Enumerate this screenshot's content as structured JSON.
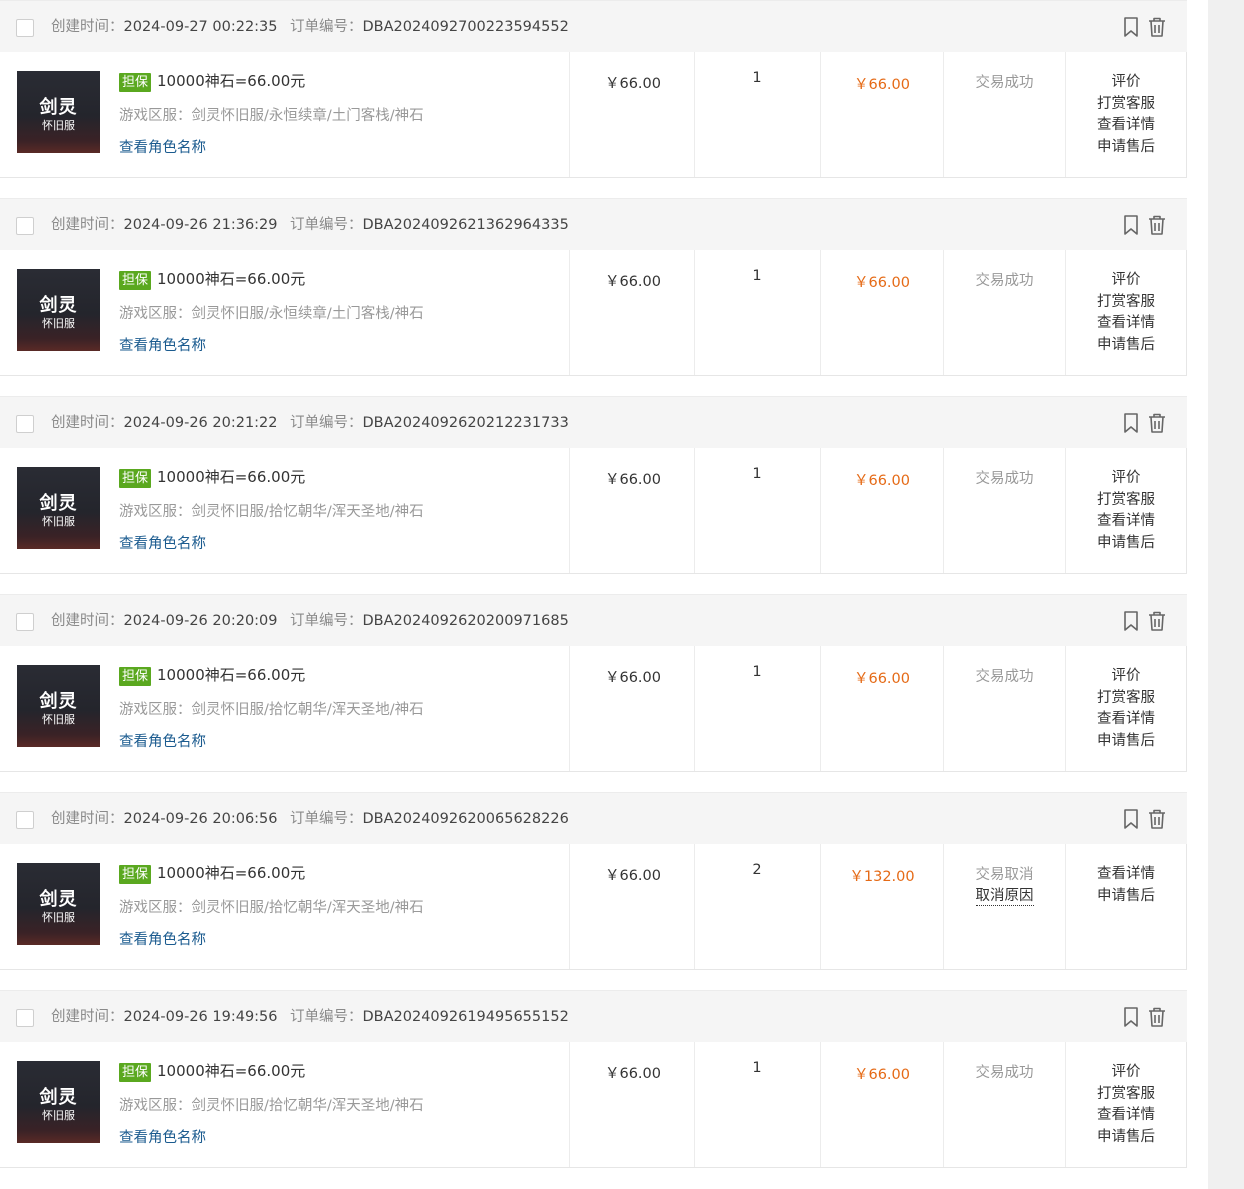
{
  "labels": {
    "created": "创建时间：",
    "order_no": "订单编号：",
    "server": "游戏区服：",
    "view_role": "查看角色名称",
    "badge": "担保"
  },
  "thumbnail": {
    "line1": "剑灵",
    "line2": "怀旧服"
  },
  "colors": {
    "accent_orange": "#e56a16",
    "badge_green": "#5aa81f",
    "link_blue": "#1b5b8f"
  },
  "orders": [
    {
      "created": "2024-09-27 00:22:35",
      "order_no": "DBA2024092700223594552",
      "product": "10000神石=66.00元",
      "server": "剑灵怀旧服/永恒续章/土门客栈/神石",
      "price": "￥66.00",
      "qty": "1",
      "total": "￥66.00",
      "status": "交易成功",
      "status_link": "",
      "actions": [
        "评价",
        "打赏客服",
        "查看详情",
        "申请售后"
      ]
    },
    {
      "created": "2024-09-26 21:36:29",
      "order_no": "DBA2024092621362964335",
      "product": "10000神石=66.00元",
      "server": "剑灵怀旧服/永恒续章/土门客栈/神石",
      "price": "￥66.00",
      "qty": "1",
      "total": "￥66.00",
      "status": "交易成功",
      "status_link": "",
      "actions": [
        "评价",
        "打赏客服",
        "查看详情",
        "申请售后"
      ]
    },
    {
      "created": "2024-09-26 20:21:22",
      "order_no": "DBA2024092620212231733",
      "product": "10000神石=66.00元",
      "server": "剑灵怀旧服/拾忆朝华/浑天圣地/神石",
      "price": "￥66.00",
      "qty": "1",
      "total": "￥66.00",
      "status": "交易成功",
      "status_link": "",
      "actions": [
        "评价",
        "打赏客服",
        "查看详情",
        "申请售后"
      ]
    },
    {
      "created": "2024-09-26 20:20:09",
      "order_no": "DBA2024092620200971685",
      "product": "10000神石=66.00元",
      "server": "剑灵怀旧服/拾忆朝华/浑天圣地/神石",
      "price": "￥66.00",
      "qty": "1",
      "total": "￥66.00",
      "status": "交易成功",
      "status_link": "",
      "actions": [
        "评价",
        "打赏客服",
        "查看详情",
        "申请售后"
      ]
    },
    {
      "created": "2024-09-26 20:06:56",
      "order_no": "DBA2024092620065628226",
      "product": "10000神石=66.00元",
      "server": "剑灵怀旧服/拾忆朝华/浑天圣地/神石",
      "price": "￥66.00",
      "qty": "2",
      "total": "￥132.00",
      "status": "交易取消",
      "status_link": "取消原因",
      "actions": [
        "查看详情",
        "申请售后"
      ]
    },
    {
      "created": "2024-09-26 19:49:56",
      "order_no": "DBA2024092619495655152",
      "product": "10000神石=66.00元",
      "server": "剑灵怀旧服/拾忆朝华/浑天圣地/神石",
      "price": "￥66.00",
      "qty": "1",
      "total": "￥66.00",
      "status": "交易成功",
      "status_link": "",
      "actions": [
        "评价",
        "打赏客服",
        "查看详情",
        "申请售后"
      ]
    }
  ]
}
